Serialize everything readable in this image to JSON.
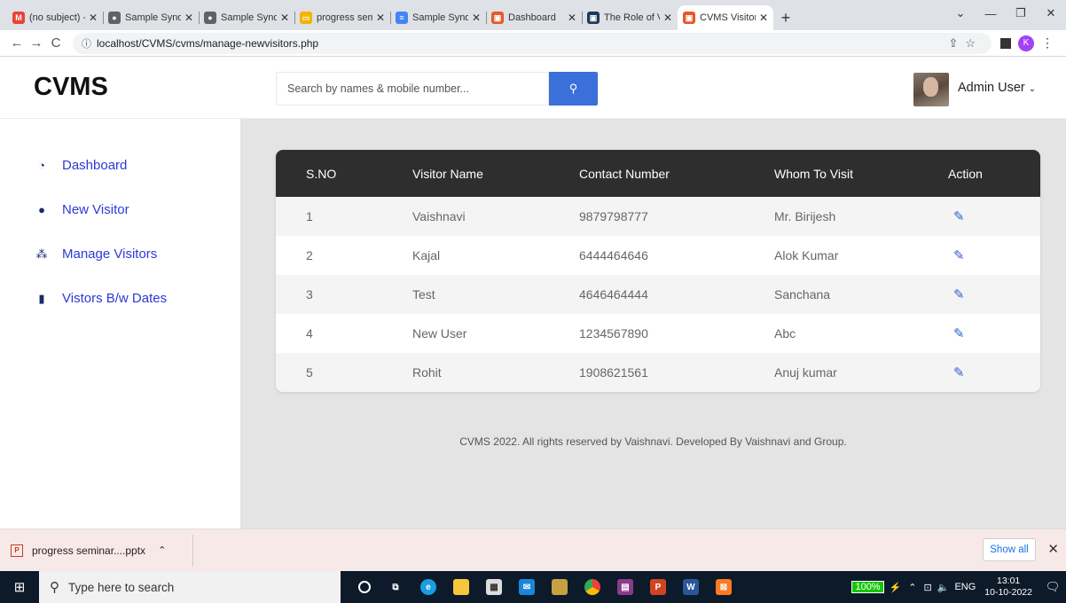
{
  "browser": {
    "tabs": [
      {
        "title": "(no subject) -",
        "fav": "M",
        "color": "#ea4335"
      },
      {
        "title": "Sample Synop",
        "fav": "●",
        "color": "#5f6368"
      },
      {
        "title": "Sample Synop",
        "fav": "●",
        "color": "#5f6368"
      },
      {
        "title": "progress sem",
        "fav": "▭",
        "color": "#f4b400"
      },
      {
        "title": "Sample Synop",
        "fav": "≡",
        "color": "#4285f4"
      },
      {
        "title": "Dashboard",
        "fav": "▣",
        "color": "#e8572a"
      },
      {
        "title": "The Role of V",
        "fav": "▣",
        "color": "#1a3a5c"
      },
      {
        "title": "CVMS Visitor",
        "fav": "▣",
        "color": "#e8572a"
      }
    ],
    "url": "localhost/CVMS/cvms/manage-newvisitors.php",
    "profile_initial": "K"
  },
  "app": {
    "brand": "CVMS",
    "search_placeholder": "Search by names & mobile number...",
    "user_name": "Admin User",
    "nav": [
      {
        "label": "Dashboard",
        "icon": "dashboard-icon"
      },
      {
        "label": "New Visitor",
        "icon": "user-icon"
      },
      {
        "label": "Manage Visitors",
        "icon": "users-icon"
      },
      {
        "label": "Vistors B/w Dates",
        "icon": "copy-icon"
      }
    ],
    "table": {
      "headers": [
        "S.NO",
        "Visitor Name",
        "Contact Number",
        "Whom To Visit",
        "Action"
      ],
      "rows": [
        [
          "1",
          "Vaishnavi",
          "9879798777",
          "Mr. Birijesh"
        ],
        [
          "2",
          "Kajal",
          "6444464646",
          "Alok Kumar"
        ],
        [
          "3",
          "Test",
          "4646464444",
          "Sanchana"
        ],
        [
          "4",
          "New User",
          "1234567890",
          "Abc"
        ],
        [
          "5",
          "Rohit",
          "1908621561",
          "Anuj kumar"
        ]
      ]
    },
    "footer": "CVMS 2022. All rights reserved by Vaishnavi. Developed By Vaishnavi and Group."
  },
  "downloads": {
    "file": "progress seminar....pptx",
    "show_all": "Show all"
  },
  "taskbar": {
    "search_placeholder": "Type here to search",
    "battery": "100%",
    "lang": "ENG",
    "time": "13:01",
    "date": "10-10-2022"
  }
}
